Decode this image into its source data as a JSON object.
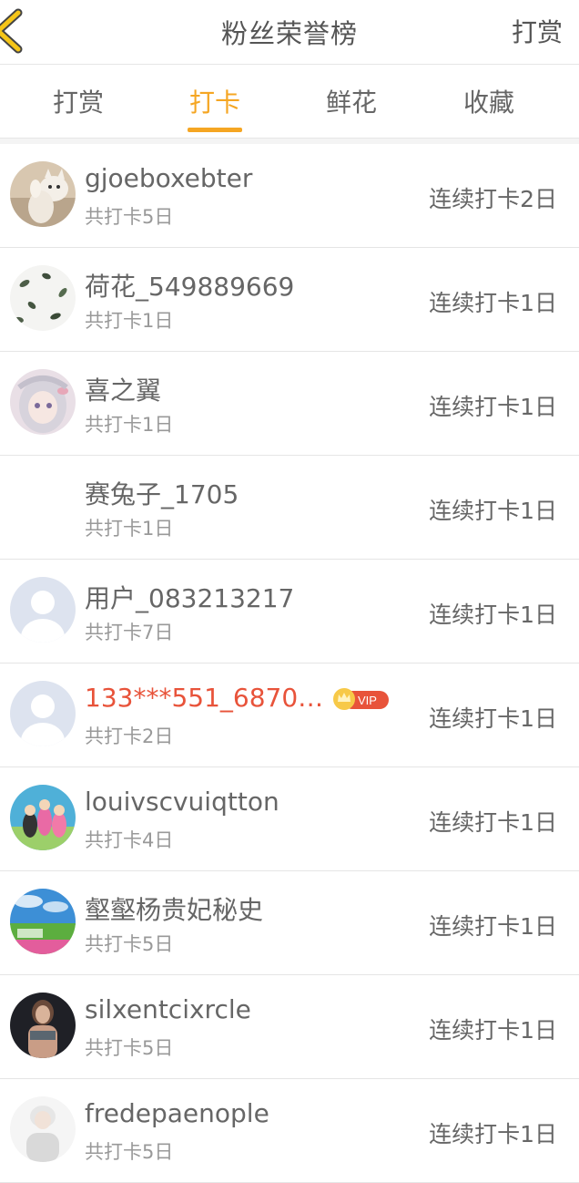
{
  "header": {
    "title": "粉丝荣誉榜",
    "right_action": "打赏",
    "back_icon": "chevron-left-icon",
    "accent_color": "#f5c518"
  },
  "tabs": [
    {
      "label": "打赏",
      "active": false
    },
    {
      "label": "打卡",
      "active": true
    },
    {
      "label": "鲜花",
      "active": false
    },
    {
      "label": "收藏",
      "active": false
    }
  ],
  "tab_active_color": "#f5a623",
  "rows": [
    {
      "name": "gjoeboxebter",
      "total": "共打卡5日",
      "streak": "连续打卡2日",
      "avatar": "cat-photo",
      "vip": false
    },
    {
      "name": "荷花_549889669",
      "total": "共打卡1日",
      "streak": "连续打卡1日",
      "avatar": "leaves-pattern",
      "vip": false
    },
    {
      "name": "喜之翼",
      "total": "共打卡1日",
      "streak": "连续打卡1日",
      "avatar": "anime-girl",
      "vip": false
    },
    {
      "name": "赛兔子_1705",
      "total": "共打卡1日",
      "streak": "连续打卡1日",
      "avatar": "none",
      "vip": false
    },
    {
      "name": "用户_083213217",
      "total": "共打卡7日",
      "streak": "连续打卡1日",
      "avatar": "default-user",
      "vip": false
    },
    {
      "name": "133***551_6870…",
      "total": "共打卡2日",
      "streak": "连续打卡1日",
      "avatar": "default-user",
      "vip": true,
      "vip_label": "VIP",
      "vip_color": "#e8533a"
    },
    {
      "name": "louivscvuiqtton",
      "total": "共打卡4日",
      "streak": "连续打卡1日",
      "avatar": "cartoon-group",
      "vip": false
    },
    {
      "name": "壑壑杨贵妃秘史",
      "total": "共打卡5日",
      "streak": "连续打卡1日",
      "avatar": "landscape",
      "vip": false
    },
    {
      "name": "silxentcixrcle",
      "total": "共打卡5日",
      "streak": "连续打卡1日",
      "avatar": "fitness-woman",
      "vip": false
    },
    {
      "name": "fredepaenople",
      "total": "共打卡5日",
      "streak": "连续打卡1日",
      "avatar": "white-hair-boy",
      "vip": false
    }
  ]
}
